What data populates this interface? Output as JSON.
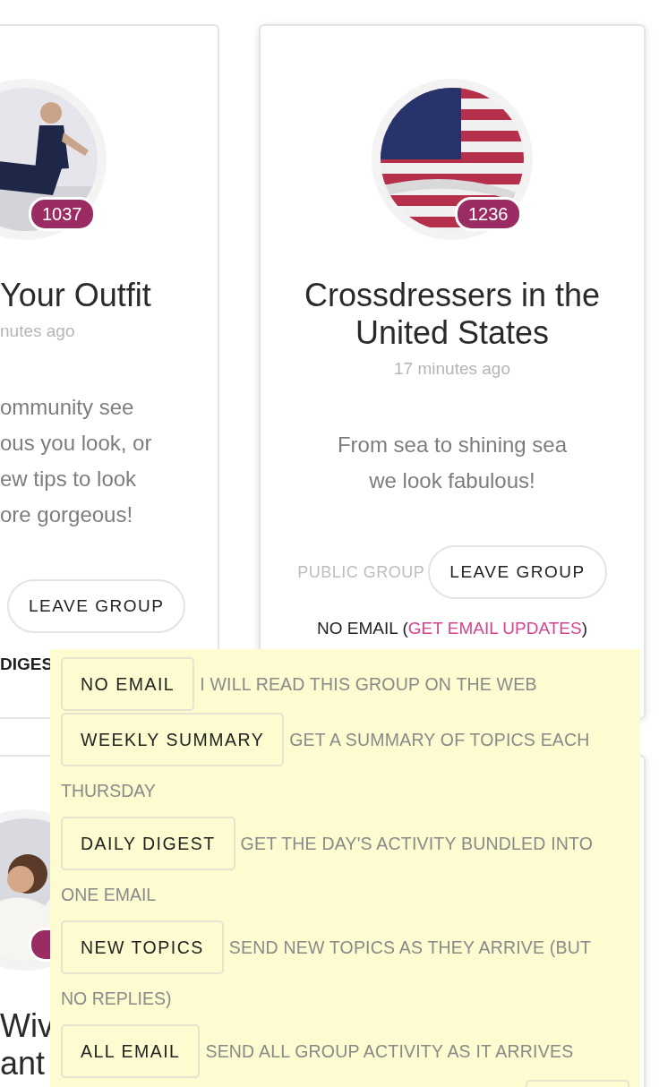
{
  "groups": [
    {
      "kind": "clipped",
      "members": "1037",
      "title_lines": [
        "Your Outfit"
      ],
      "time": "nutes ago",
      "description_lines": [
        "ommunity see",
        "ous you look, or",
        "ew tips to look",
        "ore gorgeous!"
      ],
      "leave_button": "LEAVE GROUP",
      "email_setting": "DIGES"
    },
    {
      "kind": "full",
      "members": "1236",
      "title_lines": [
        "Crossdressers in the",
        "United States"
      ],
      "time": "17 minutes ago",
      "description_lines": [
        "From sea to shining sea",
        "we look fabulous!"
      ],
      "privacy": "PUBLIC GROUP",
      "leave_button": "LEAVE GROUP",
      "email_setting": "NO EMAIL (",
      "email_link": "GET EMAIL UPDATES",
      "email_close": ")"
    },
    {
      "kind": "clipped",
      "title_lines": [
        "Wiv",
        "ant"
      ]
    },
    {
      "kind": "full"
    }
  ],
  "email_popup": {
    "options": [
      {
        "label": "NO EMAIL",
        "description_lines": [
          "I WILL READ THIS GROUP ON THE WEB"
        ]
      },
      {
        "label": "WEEKLY SUMMARY",
        "description_lines": [
          "GET A SUMMARY OF TOPICS EACH",
          "THURSDAY"
        ]
      },
      {
        "label": "DAILY DIGEST",
        "description_lines": [
          "GET THE DAY'S ACTIVITY BUNDLED INTO",
          "ONE EMAIL"
        ]
      },
      {
        "label": "NEW TOPICS",
        "description_lines": [
          "SEND NEW TOPICS AS THEY ARRIVE (BUT",
          "NO REPLIES)"
        ]
      },
      {
        "label": "ALL EMAIL",
        "description_lines": [
          "SEND ALL GROUP ACTIVITY AS IT ARRIVES"
        ]
      }
    ]
  }
}
